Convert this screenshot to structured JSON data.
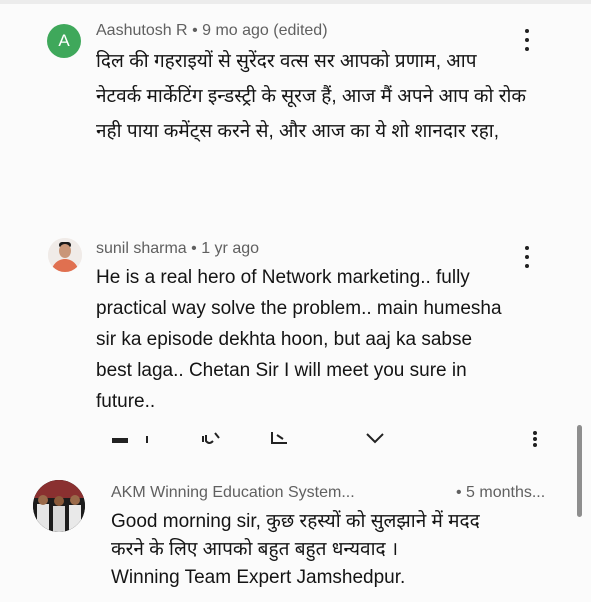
{
  "comments": [
    {
      "author": "Aashutosh R",
      "time": "• 9 mo ago (edited)",
      "avatar_letter": "A",
      "lines": [
        "दिल की गहराइयों से सुरेंदर वत्स सर आपको प्रणाम, आप",
        "नेटवर्क मार्केटिंग इन्डस्ट्री के सूरज हैं, आज मैं अपने आप को रोक",
        "नही पाया कमेंट्स करने से, और आज का ये शो शानदार रहा,"
      ]
    },
    {
      "author": "sunil sharma",
      "time": "• 1 yr ago",
      "lines": [
        "He is a real hero of Network marketing.. fully",
        "practical way solve the problem.. main humesha",
        "sir ka episode dekhta hoon, but aaj ka sabse",
        "best laga.. Chetan Sir I will meet you sure in",
        "future.."
      ]
    },
    {
      "author": "AKM Winning Education System...",
      "time": "• 5 months...",
      "lines": [
        "Good morning sir,  कुछ रहस्यों को सुलझाने में मदद",
        "करने के लिए आपको बहुत बहुत धन्यवाद ।",
        "Winning Team Expert Jamshedpur."
      ]
    }
  ],
  "icons": {
    "like": "thumbs-up-icon",
    "dislike": "thumbs-down-icon",
    "reply": "reply-icon",
    "more": "more-vertical-icon",
    "expand": "chevron-down-icon"
  },
  "colors": {
    "avatar_a": "#3fa85b",
    "meta_text": "#606060",
    "body_text": "#141414",
    "scrollbar": "#8e8e8e"
  }
}
